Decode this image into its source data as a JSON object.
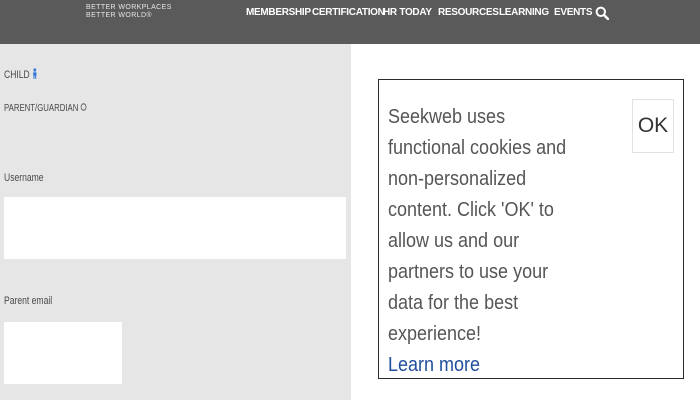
{
  "header": {
    "brand_line1": "BETTER WORKPLACES",
    "brand_line2": "BETTER WORLD®",
    "nav": [
      {
        "label": "MEMBERSHIP"
      },
      {
        "label": "CERTIFICATION"
      },
      {
        "label": "HR TODAY"
      },
      {
        "label": "RESOURCES"
      },
      {
        "label": "LEARNING"
      },
      {
        "label": "EVENTS"
      }
    ],
    "search_icon": "search-icon"
  },
  "form": {
    "child_label": "CHILD",
    "child_icon": "person-icon",
    "parent_label": "PARENT/GUARDIAN",
    "parent_icon": "radio-icon",
    "username_label": "Username",
    "username_value": "",
    "parent_email_label": "Parent email",
    "parent_email_value": ""
  },
  "cookie_banner": {
    "message": "Seekweb uses functional cookies and non-personalized content. Click 'OK' to allow us and our partners to use your data for the best experience!",
    "learn_more": "Learn more",
    "ok_label": "OK"
  },
  "colors": {
    "header_bg": "#5a5a5a",
    "panel_bg": "#e6e6e6",
    "link": "#1f4e9c",
    "accent_icon": "#3a7bd5"
  }
}
